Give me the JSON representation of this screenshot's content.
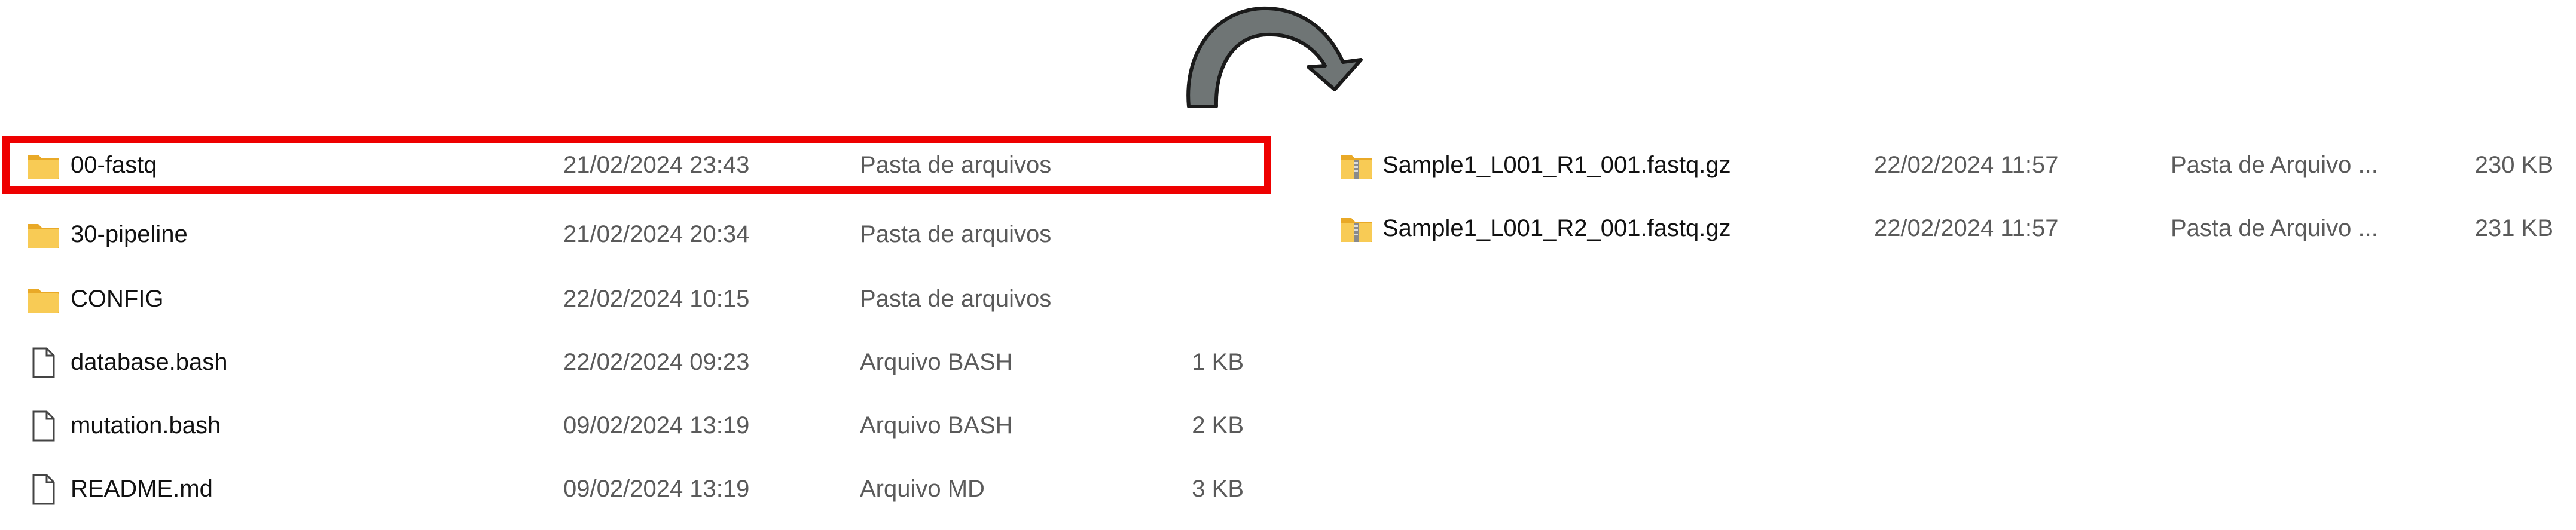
{
  "left_pane": {
    "items": [
      {
        "name": "00-fastq",
        "date": "21/02/2024 23:43",
        "type": "Pasta de arquivos",
        "size": "",
        "icon": "folder-icon"
      },
      {
        "name": "30-pipeline",
        "date": "21/02/2024 20:34",
        "type": "Pasta de arquivos",
        "size": "",
        "icon": "folder-icon"
      },
      {
        "name": "CONFIG",
        "date": "22/02/2024 10:15",
        "type": "Pasta de arquivos",
        "size": "",
        "icon": "folder-icon"
      },
      {
        "name": "database.bash",
        "date": "22/02/2024 09:23",
        "type": "Arquivo BASH",
        "size": "1 KB",
        "icon": "file-icon"
      },
      {
        "name": "mutation.bash",
        "date": "09/02/2024 13:19",
        "type": "Arquivo BASH",
        "size": "2 KB",
        "icon": "file-icon"
      },
      {
        "name": "README.md",
        "date": "09/02/2024 13:19",
        "type": "Arquivo MD",
        "size": "3 KB",
        "icon": "file-icon"
      }
    ]
  },
  "right_pane": {
    "items": [
      {
        "name": "Sample1_L001_R1_001.fastq.gz",
        "date": "22/02/2024 11:57",
        "type": "Pasta de Arquivo ...",
        "size": "230 KB",
        "icon": "zip-folder-icon"
      },
      {
        "name": "Sample1_L001_R2_001.fastq.gz",
        "date": "22/02/2024 11:57",
        "type": "Pasta de Arquivo ...",
        "size": "231 KB",
        "icon": "zip-folder-icon"
      }
    ]
  },
  "colors": {
    "highlight": "#ee0000",
    "arrow_fill": "#6f7575",
    "arrow_stroke": "#1a1a1a",
    "folder": "#f5c242"
  }
}
